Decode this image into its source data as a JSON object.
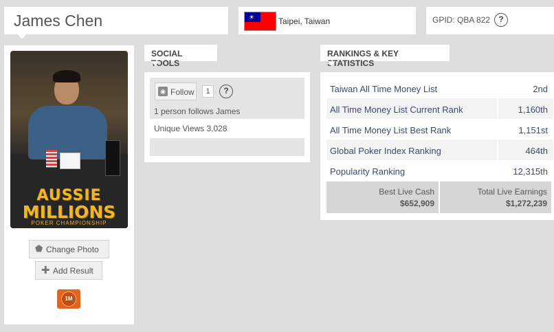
{
  "player": {
    "name": "James Chen"
  },
  "location": {
    "text": "Taipei, Taiwan",
    "flag": "taiwan-flag"
  },
  "gpid": {
    "text": "GPID: QBA 822",
    "help": "?"
  },
  "photo_panel": {
    "logo_line1": "AUSSIE",
    "logo_line2": "MILLIONS",
    "logo_line3": "POKER CHAMPIONSHIP",
    "change_photo_label": "Change Photo",
    "add_result_label": "Add Result",
    "badge_label": "1M"
  },
  "social": {
    "header": "SOCIAL TOOLS",
    "follow_label": "Follow",
    "follow_count": "1",
    "help": "?",
    "follows_text": "1 person follows James",
    "views_text": "Unique Views 3,028"
  },
  "rankings": {
    "header": "RANKINGS & KEY STATISTICS",
    "rows": [
      {
        "label": "Taiwan All Time Money List",
        "value": "2nd"
      },
      {
        "label": "All Time Money List Current Rank",
        "value": "1,160th"
      },
      {
        "label": "All Time Money List Best Rank",
        "value": "1,151st"
      },
      {
        "label": "Global Poker Index Ranking",
        "value": "464th"
      },
      {
        "label": "Popularity Ranking",
        "value": "12,315th"
      }
    ],
    "best_live_cash_label": "Best Live Cash",
    "best_live_cash_value": "$652,909",
    "total_live_earnings_label": "Total Live Earnings",
    "total_live_earnings_value": "$1,272,239"
  },
  "colors": {
    "page_bg": "#dedede",
    "link_blue": "#3b4a6e",
    "badge_orange": "#e2641d",
    "flag_red": "#fe0000",
    "flag_blue": "#000095"
  }
}
